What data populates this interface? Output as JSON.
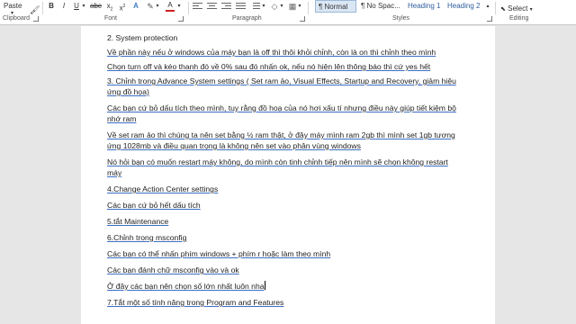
{
  "ribbon": {
    "paste_label": "Paste",
    "clipboard_label": "Clipboard",
    "font_label": "Font",
    "paragraph_label": "Paragraph",
    "styles_label": "Styles",
    "editing_label": "Editing",
    "bold": "B",
    "italic": "I",
    "underline": "U",
    "font_color_letter": "A",
    "styles": [
      "¶ Normal",
      "¶ No Spac...",
      "Heading 1",
      "Heading 2"
    ],
    "select_label": "Select"
  },
  "document": {
    "paragraphs": [
      "2. System protection",
      "Về phần này nếu ở windows của máy bạn là off thì thôi khỏi chỉnh, còn là on thì chỉnh theo mình",
      "Chọn turn off và kéo thanh đó về 0% sau đó nhấn ok, nếu nó hiện lên thông báo thì cứ yes hết",
      "3. Chỉnh trong Advance System settings ( Set ram ảo, Visual Effects, Startup and Recovery, giảm hiệu ứng đồ họa)",
      "Các bạn cứ bỏ dấu tích theo mình, tuy rằng đồ hoạ của nó hơi xấu tí nhưng điều này giúp tiết kiệm bộ nhớ ram",
      "Về set ram ảo thì chúng ta nên set bằng ½ ram thật, ở đây máy mình ram 2gb thì mình set 1gb tương ứng 1028mb và điều quan trọng là không nên set vào phân vùng windows",
      "Nó hỏi bạn có muốn restart máy không, do mình còn tinh chỉnh tiếp nên mình sẽ chọn không restart máy",
      "4.Change Action Center settings",
      "Các bạn cứ bỏ hết dấu tích",
      "5.tắt Maintenance",
      "6.Chỉnh trong msconfig",
      "Các bạn có thể nhấn phím windows + phím r hoặc làm theo mình",
      "Các bạn đánh chữ msconfig vào và ok",
      "Ở đây các bạn nên chọn số lớn nhất luôn nha",
      "7.Tắt một số tính năng trong Program and Features"
    ]
  }
}
